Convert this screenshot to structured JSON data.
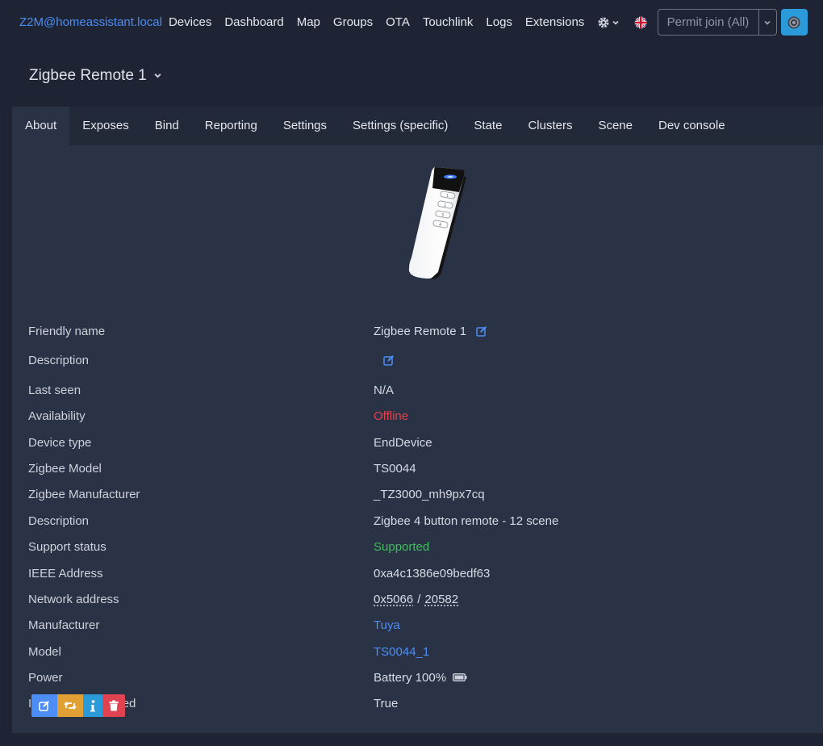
{
  "navbar": {
    "brand": "Z2M@homeassistant.local",
    "items": [
      "Devices",
      "Dashboard",
      "Map",
      "Groups",
      "OTA",
      "Touchlink",
      "Logs",
      "Extensions"
    ],
    "settings_icon": "gear-icon",
    "language_icon": "uk-flag-icon",
    "permit_join_label": "Permit join (All)",
    "bug_icon": "bug-icon"
  },
  "device": {
    "title": "Zigbee Remote 1"
  },
  "tabs": [
    "About",
    "Exposes",
    "Bind",
    "Reporting",
    "Settings",
    "Settings (specific)",
    "State",
    "Clusters",
    "Scene",
    "Dev console"
  ],
  "active_tab": "About",
  "properties": {
    "friendly_name": {
      "label": "Friendly name",
      "value": "Zigbee Remote 1"
    },
    "description_edit": {
      "label": "Description",
      "value": ""
    },
    "last_seen": {
      "label": "Last seen",
      "value": "N/A"
    },
    "availability": {
      "label": "Availability",
      "value": "Offline"
    },
    "device_type": {
      "label": "Device type",
      "value": "EndDevice"
    },
    "zigbee_model": {
      "label": "Zigbee Model",
      "value": "TS0044"
    },
    "zigbee_manufacturer": {
      "label": "Zigbee Manufacturer",
      "value": "_TZ3000_mh9px7cq"
    },
    "description": {
      "label": "Description",
      "value": "Zigbee 4 button remote - 12 scene"
    },
    "support_status": {
      "label": "Support status",
      "value": "Supported"
    },
    "ieee_address": {
      "label": "IEEE Address",
      "value": "0xa4c1386e09bedf63"
    },
    "network_address": {
      "label": "Network address",
      "hex": "0x5066",
      "sep": "/",
      "dec": "20582"
    },
    "manufacturer": {
      "label": "Manufacturer",
      "value": "Tuya"
    },
    "model": {
      "label": "Model",
      "value": "TS0044_1"
    },
    "power": {
      "label": "Power",
      "value": "Battery 100%"
    },
    "interview_completed": {
      "label": "Interview completed",
      "value": "True"
    }
  },
  "colors": {
    "accent": "#4c8df6",
    "offline": "#e0434f",
    "supported": "#3fbf5a",
    "rename": "#4c8df6",
    "reconfigure": "#e0a034",
    "interview": "#2b9ad8",
    "remove": "#e0434f"
  }
}
